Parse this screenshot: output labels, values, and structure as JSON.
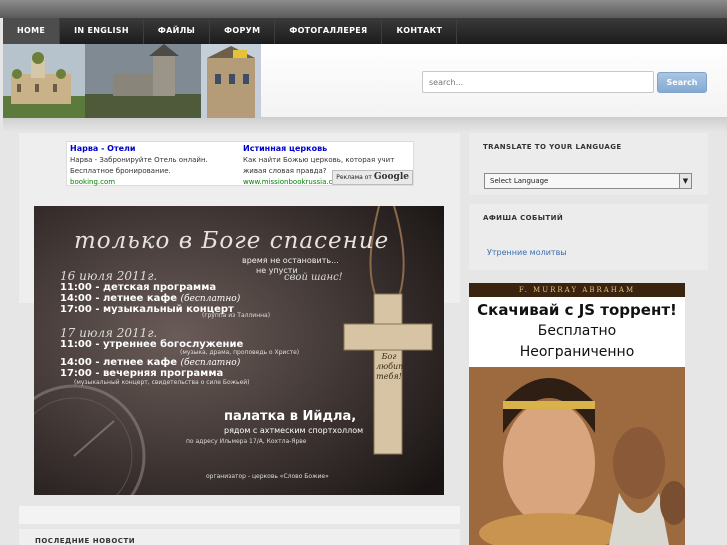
{
  "nav": {
    "items": [
      {
        "label": "HOME",
        "active": true
      },
      {
        "label": "IN ENGLISH",
        "active": false
      },
      {
        "label": "ФАЙЛЫ",
        "active": false
      },
      {
        "label": "ФОРУМ",
        "active": false
      },
      {
        "label": "ФОТОГАЛЛЕРЕЯ",
        "active": false
      },
      {
        "label": "КОНТАКТ",
        "active": false
      }
    ]
  },
  "search": {
    "placeholder": "search...",
    "button_label": "Search"
  },
  "ads": {
    "left": {
      "title": "Нарва - Отели",
      "text1": "Нарва - Забронируйте Отель онлайн.",
      "text2": "Бесплатное бронирование.",
      "url": "booking.com"
    },
    "right": {
      "title": "Истинная церковь",
      "text1": "Как найти Божью церковь, которая учит",
      "text2": "живая словая правда?",
      "url": "www.missionbookrussia.com"
    },
    "badge_prefix": "Реклама от",
    "badge_brand": "Google"
  },
  "poster": {
    "headline": "только в Боге спасение",
    "tagline1": "время не остановить...",
    "tagline2": "не упусти",
    "tagline3": "свой шанс!",
    "date1": "16 июля 2011г.",
    "day1": [
      {
        "time": "11:00",
        "text": "- детская программа"
      },
      {
        "time": "14:00",
        "text": "- летнее кафе",
        "note": "(бесплатно)"
      },
      {
        "time": "17:00",
        "text": "- музыкальный концерт",
        "note": "(группа из Таллинна)"
      }
    ],
    "date2": "17 июля 2011г.",
    "day2": [
      {
        "time": "11:00",
        "text": "- утреннее богослужение",
        "note": "(музыка, драма, проповедь о Христе)"
      },
      {
        "time": "14:00",
        "text": "- летнее кафе",
        "note": "(бесплатно)"
      },
      {
        "time": "17:00",
        "text": "- вечерняя программа",
        "note": "(музыкальный концерт, свидетельства о силе Божьей)"
      }
    ],
    "tent_title": "палатка в Ийдла,",
    "tent_sub": "рядом с ахтмеским спортхоллом",
    "address": "по адресу Ильмера 17/А, Кохтла-Ярве",
    "organizer": "организатор - церковь «Слово Божие»",
    "cross_text": "Бог любит тебя!"
  },
  "sidebar": {
    "translate_title": "TRANSLATE TO YOUR LANGUAGE",
    "select_value": "Select Language",
    "events_title": "АФИША СОБЫТИЙ",
    "event_link": "Утренние молитвы",
    "ad_top": "F. MURRAY ABRAHAM",
    "ad_line1": "Скачивай с JS торрент!",
    "ad_line2": "Бесплатно",
    "ad_line3": "Неограниченно"
  },
  "news": {
    "title": "ПОСЛЕДНИЕ НОВОСТИ"
  }
}
